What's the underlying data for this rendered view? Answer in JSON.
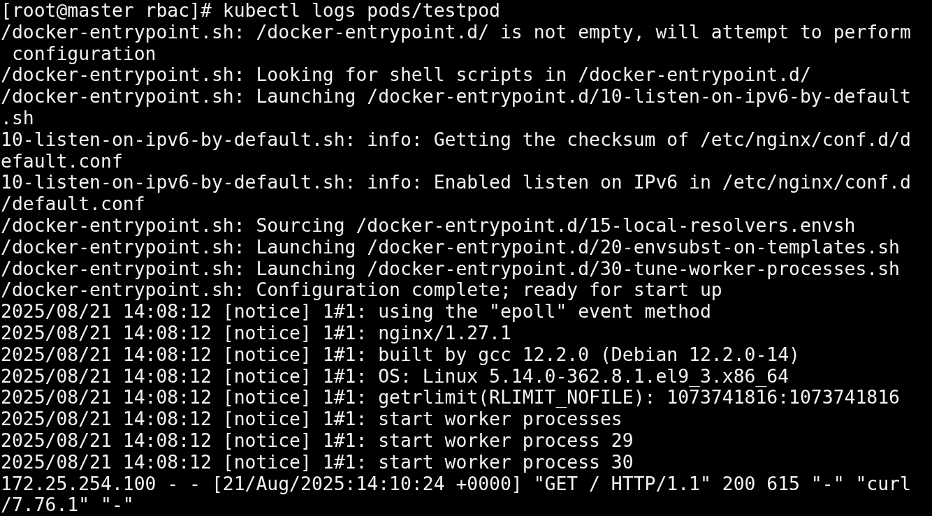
{
  "terminal": {
    "lines": [
      "[root@master rbac]# kubectl logs pods/testpod",
      "/docker-entrypoint.sh: /docker-entrypoint.d/ is not empty, will attempt to perform",
      " configuration",
      "/docker-entrypoint.sh: Looking for shell scripts in /docker-entrypoint.d/",
      "/docker-entrypoint.sh: Launching /docker-entrypoint.d/10-listen-on-ipv6-by-default",
      ".sh",
      "10-listen-on-ipv6-by-default.sh: info: Getting the checksum of /etc/nginx/conf.d/d",
      "efault.conf",
      "10-listen-on-ipv6-by-default.sh: info: Enabled listen on IPv6 in /etc/nginx/conf.d",
      "/default.conf",
      "/docker-entrypoint.sh: Sourcing /docker-entrypoint.d/15-local-resolvers.envsh",
      "/docker-entrypoint.sh: Launching /docker-entrypoint.d/20-envsubst-on-templates.sh",
      "/docker-entrypoint.sh: Launching /docker-entrypoint.d/30-tune-worker-processes.sh",
      "/docker-entrypoint.sh: Configuration complete; ready for start up",
      "2025/08/21 14:08:12 [notice] 1#1: using the \"epoll\" event method",
      "2025/08/21 14:08:12 [notice] 1#1: nginx/1.27.1",
      "2025/08/21 14:08:12 [notice] 1#1: built by gcc 12.2.0 (Debian 12.2.0-14)",
      "2025/08/21 14:08:12 [notice] 1#1: OS: Linux 5.14.0-362.8.1.el9_3.x86_64",
      "2025/08/21 14:08:12 [notice] 1#1: getrlimit(RLIMIT_NOFILE): 1073741816:1073741816",
      "2025/08/21 14:08:12 [notice] 1#1: start worker processes",
      "2025/08/21 14:08:12 [notice] 1#1: start worker process 29",
      "2025/08/21 14:08:12 [notice] 1#1: start worker process 30",
      "172.25.254.100 - - [21/Aug/2025:14:10:24 +0000] \"GET / HTTP/1.1\" 200 615 \"-\" \"curl",
      "/7.76.1\" \"-\""
    ]
  }
}
